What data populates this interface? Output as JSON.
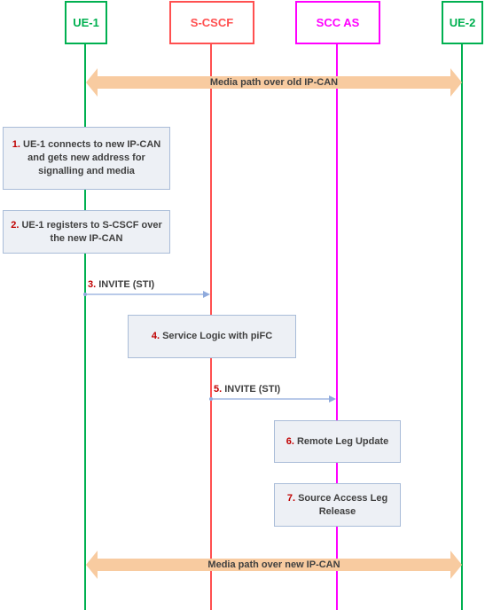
{
  "entities": [
    {
      "id": "ue1",
      "label": "UE-1",
      "color": "#00b050"
    },
    {
      "id": "scscf",
      "label": "S-CSCF",
      "color": "#ff5050"
    },
    {
      "id": "sccas",
      "label": "SCC AS",
      "color": "#ff00ff"
    },
    {
      "id": "ue2",
      "label": "UE-2",
      "color": "#00b050"
    }
  ],
  "media_paths": [
    {
      "label": "Media path over old IP-CAN",
      "from": "ue1",
      "to": "ue2",
      "color": "#f8cba0"
    },
    {
      "label": "Media path over new IP-CAN",
      "from": "ue1",
      "to": "ue2",
      "color": "#f8cba0"
    }
  ],
  "steps": [
    {
      "num": "1.",
      "text": "UE-1 connects to new IP-CAN and gets new address for signalling and media",
      "type": "action",
      "at": "ue1"
    },
    {
      "num": "2.",
      "text": "UE-1 registers to S-CSCF over the new IP-CAN",
      "type": "action",
      "at": "ue1"
    },
    {
      "num": "3.",
      "text": "INVITE (STI)",
      "type": "message",
      "from": "ue1",
      "to": "scscf"
    },
    {
      "num": "4.",
      "text": "Service Logic with piFC",
      "type": "action",
      "at": "scscf"
    },
    {
      "num": "5.",
      "text": "INVITE (STI)",
      "type": "message",
      "from": "scscf",
      "to": "sccas"
    },
    {
      "num": "6.",
      "text": "Remote Leg Update",
      "type": "action",
      "at": "sccas"
    },
    {
      "num": "7.",
      "text": "Source Access Leg Release",
      "type": "action",
      "at": "sccas"
    }
  ],
  "colors": {
    "step_number": "#c00000",
    "step_box_fill": "#edf0f5",
    "step_box_border": "#a9bcd8",
    "message_arrow": "#8faadc"
  }
}
